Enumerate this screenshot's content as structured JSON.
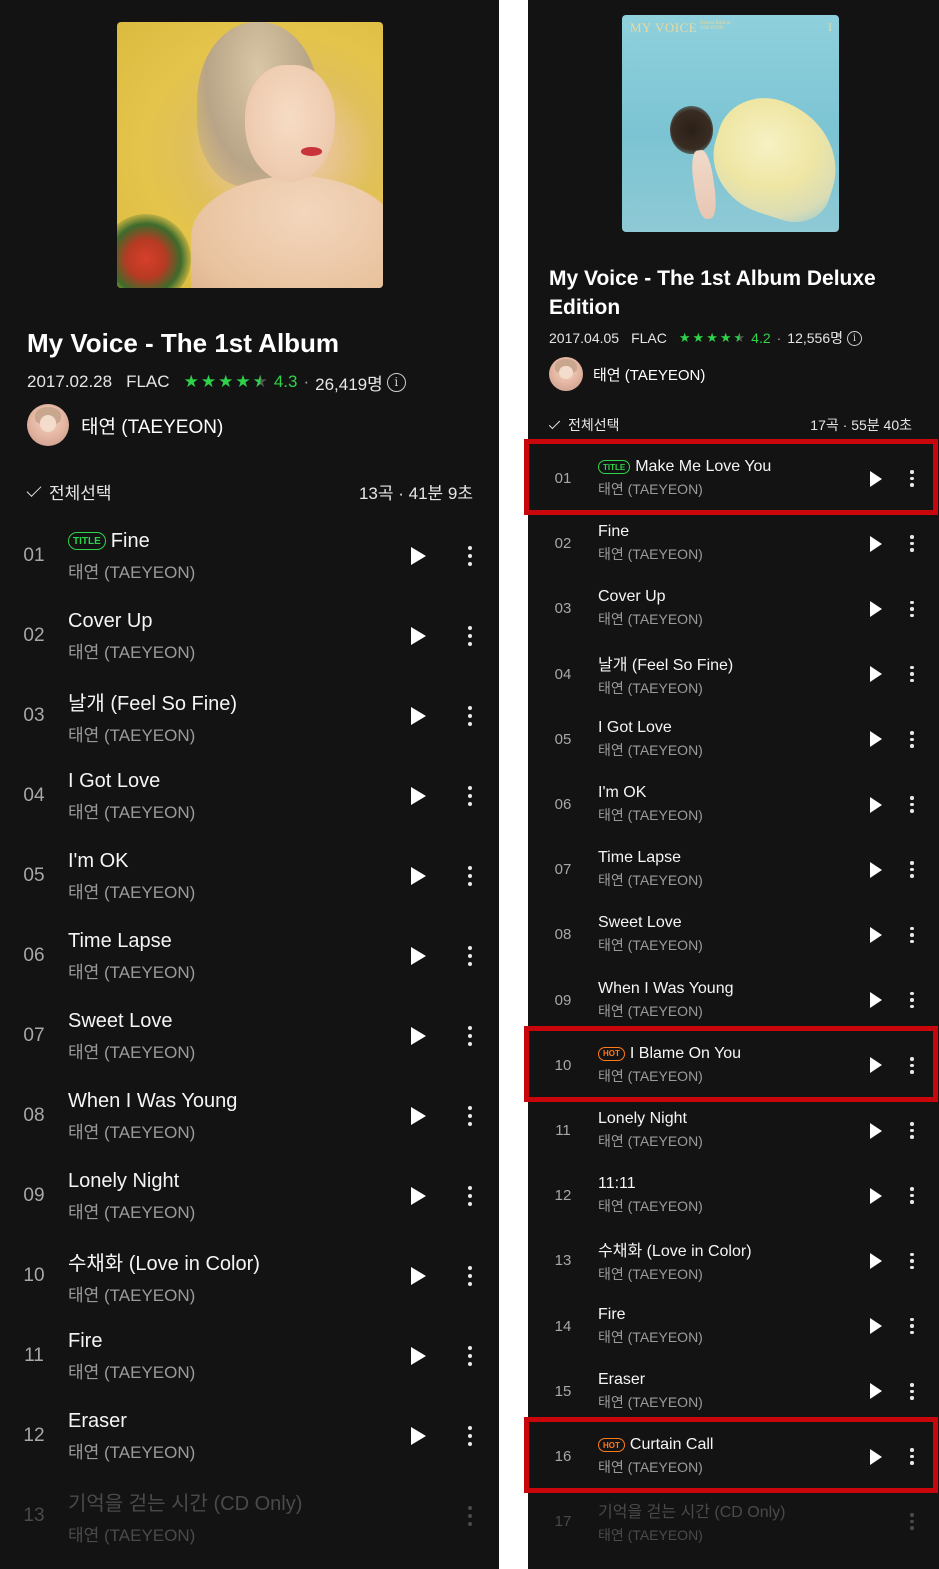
{
  "left": {
    "album_title": "My Voice - The 1st Album",
    "date": "2017.02.28",
    "format": "FLAC",
    "rating": "4.3",
    "rating_stars": 4.5,
    "rating_count": "26,419명",
    "artist": "태연 (TAEYEON)",
    "select_all": "전체선택",
    "summary": "13곡 · 41분 9초",
    "tracks": [
      {
        "num": "01",
        "title": "Fine",
        "artist": "태연 (TAEYEON)",
        "badge": "TITLE"
      },
      {
        "num": "02",
        "title": "Cover Up",
        "artist": "태연 (TAEYEON)"
      },
      {
        "num": "03",
        "title": "날개 (Feel So Fine)",
        "artist": "태연 (TAEYEON)"
      },
      {
        "num": "04",
        "title": "I Got Love",
        "artist": "태연 (TAEYEON)"
      },
      {
        "num": "05",
        "title": "I'm OK",
        "artist": "태연 (TAEYEON)"
      },
      {
        "num": "06",
        "title": "Time Lapse",
        "artist": "태연 (TAEYEON)"
      },
      {
        "num": "07",
        "title": "Sweet Love",
        "artist": "태연 (TAEYEON)"
      },
      {
        "num": "08",
        "title": "When I Was Young",
        "artist": "태연 (TAEYEON)"
      },
      {
        "num": "09",
        "title": "Lonely Night",
        "artist": "태연 (TAEYEON)"
      },
      {
        "num": "10",
        "title": "수채화 (Love in Color)",
        "artist": "태연 (TAEYEON)"
      },
      {
        "num": "11",
        "title": "Fire",
        "artist": "태연 (TAEYEON)"
      },
      {
        "num": "12",
        "title": "Eraser",
        "artist": "태연 (TAEYEON)"
      },
      {
        "num": "13",
        "title": "기억을 걷는 시간 (CD Only)",
        "artist": "태연 (TAEYEON)",
        "disabled": true
      }
    ]
  },
  "right": {
    "cover_text": {
      "title": "MY VOICE",
      "subtitle_line1": "Deluxe Edition",
      "subtitle_line2": "TAEYEON",
      "number": "I"
    },
    "album_title": "My Voice - The 1st Album Deluxe Edition",
    "date": "2017.04.05",
    "format": "FLAC",
    "rating": "4.2",
    "rating_stars": 4.5,
    "rating_count": "12,556명",
    "artist": "태연 (TAEYEON)",
    "select_all": "전체선택",
    "summary": "17곡 · 55분 40초",
    "tracks": [
      {
        "num": "01",
        "title": "Make Me Love You",
        "artist": "태연 (TAEYEON)",
        "badge": "TITLE",
        "highlighted": true
      },
      {
        "num": "02",
        "title": "Fine",
        "artist": "태연 (TAEYEON)"
      },
      {
        "num": "03",
        "title": "Cover Up",
        "artist": "태연 (TAEYEON)"
      },
      {
        "num": "04",
        "title": "날개 (Feel So Fine)",
        "artist": "태연 (TAEYEON)"
      },
      {
        "num": "05",
        "title": "I Got Love",
        "artist": "태연 (TAEYEON)"
      },
      {
        "num": "06",
        "title": "I'm OK",
        "artist": "태연 (TAEYEON)"
      },
      {
        "num": "07",
        "title": "Time Lapse",
        "artist": "태연 (TAEYEON)"
      },
      {
        "num": "08",
        "title": "Sweet Love",
        "artist": "태연 (TAEYEON)"
      },
      {
        "num": "09",
        "title": "When I Was Young",
        "artist": "태연 (TAEYEON)"
      },
      {
        "num": "10",
        "title": "I Blame On You",
        "artist": "태연 (TAEYEON)",
        "badge": "HOT",
        "highlighted": true
      },
      {
        "num": "11",
        "title": "Lonely Night",
        "artist": "태연 (TAEYEON)"
      },
      {
        "num": "12",
        "title": "11:11",
        "artist": "태연 (TAEYEON)"
      },
      {
        "num": "13",
        "title": "수채화 (Love in Color)",
        "artist": "태연 (TAEYEON)"
      },
      {
        "num": "14",
        "title": "Fire",
        "artist": "태연 (TAEYEON)"
      },
      {
        "num": "15",
        "title": "Eraser",
        "artist": "태연 (TAEYEON)"
      },
      {
        "num": "16",
        "title": "Curtain Call",
        "artist": "태연 (TAEYEON)",
        "badge": "HOT",
        "highlighted": true
      },
      {
        "num": "17",
        "title": "기억을 걷는 시간 (CD Only)",
        "artist": "태연 (TAEYEON)",
        "disabled": true
      }
    ]
  },
  "colors": {
    "background": "#131313",
    "accent_green": "#2ed34a",
    "hot_orange": "#ff7a1a",
    "highlight_red": "#c8060c",
    "divider": "#ffffff"
  },
  "icons": [
    "check-icon",
    "info-icon",
    "play-icon",
    "more-vertical-icon",
    "star-icon"
  ]
}
